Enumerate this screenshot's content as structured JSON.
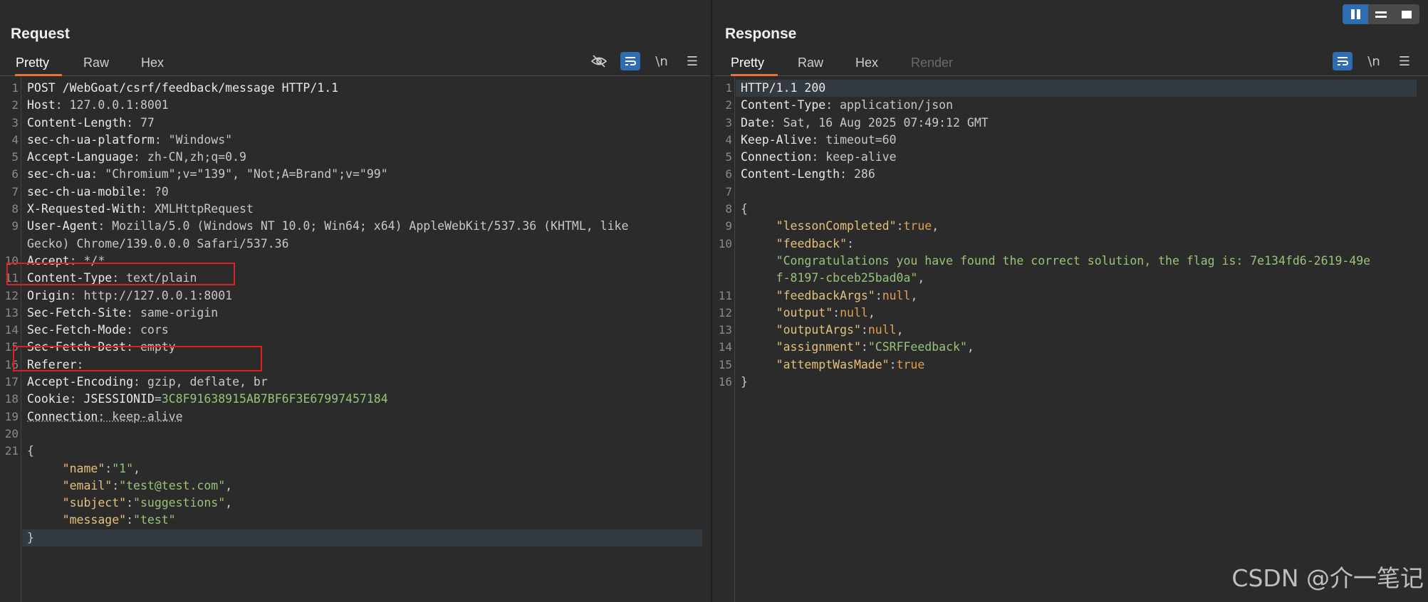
{
  "request": {
    "title": "Request",
    "tabs": [
      "Pretty",
      "Raw",
      "Hex"
    ],
    "active_tab": "Pretty",
    "lines": [
      {
        "n": "1",
        "segs": [
          [
            "k",
            "POST /WebGoat/csrf/feedback/message HTTP/1.1"
          ]
        ]
      },
      {
        "n": "2",
        "segs": [
          [
            "k",
            "Host"
          ],
          [
            "v",
            ": 127.0.0.1:8001"
          ]
        ]
      },
      {
        "n": "3",
        "segs": [
          [
            "k",
            "Content-Length"
          ],
          [
            "v",
            ": 77"
          ]
        ]
      },
      {
        "n": "4",
        "segs": [
          [
            "k",
            "sec-ch-ua-platform"
          ],
          [
            "v",
            ": \"Windows\""
          ]
        ]
      },
      {
        "n": "5",
        "segs": [
          [
            "k",
            "Accept-Language"
          ],
          [
            "v",
            ": zh-CN,zh;q=0.9"
          ]
        ]
      },
      {
        "n": "6",
        "segs": [
          [
            "k",
            "sec-ch-ua"
          ],
          [
            "v",
            ": \"Chromium\";v=\"139\", \"Not;A=Brand\";v=\"99\""
          ]
        ]
      },
      {
        "n": "7",
        "segs": [
          [
            "k",
            "sec-ch-ua-mobile"
          ],
          [
            "v",
            ": ?0"
          ]
        ]
      },
      {
        "n": "8",
        "segs": [
          [
            "k",
            "X-Requested-With"
          ],
          [
            "v",
            ": XMLHttpRequest"
          ]
        ]
      },
      {
        "n": "9",
        "segs": [
          [
            "k",
            "User-Agent"
          ],
          [
            "v",
            ": Mozilla/5.0 (Windows NT 10.0; Win64; x64) AppleWebKit/537.36 (KHTML, like"
          ]
        ]
      },
      {
        "n": "",
        "segs": [
          [
            "v",
            "Gecko) Chrome/139.0.0.0 Safari/537.36"
          ]
        ]
      },
      {
        "n": "10",
        "segs": [
          [
            "k",
            "Accept"
          ],
          [
            "v",
            ": */*"
          ]
        ]
      },
      {
        "n": "11",
        "segs": [
          [
            "k",
            "Content-Type"
          ],
          [
            "v",
            ": text/plain"
          ]
        ]
      },
      {
        "n": "12",
        "segs": [
          [
            "k",
            "Origin"
          ],
          [
            "v",
            ": http://127.0.0.1:8001"
          ]
        ]
      },
      {
        "n": "13",
        "segs": [
          [
            "k",
            "Sec-Fetch-Site"
          ],
          [
            "v",
            ": same-origin"
          ]
        ]
      },
      {
        "n": "14",
        "segs": [
          [
            "k",
            "Sec-Fetch-Mode"
          ],
          [
            "v",
            ": cors"
          ]
        ]
      },
      {
        "n": "15",
        "segs": [
          [
            "k",
            "Sec-Fetch-Dest"
          ],
          [
            "v",
            ": empty"
          ]
        ]
      },
      {
        "n": "16",
        "segs": [
          [
            "k",
            "Referer"
          ],
          [
            "v",
            ":"
          ]
        ]
      },
      {
        "n": "17",
        "segs": [
          [
            "k",
            "Accept-Encoding"
          ],
          [
            "v",
            ": gzip, deflate, br"
          ]
        ]
      },
      {
        "n": "18",
        "segs": [
          [
            "k",
            "Cookie"
          ],
          [
            "v",
            ": "
          ],
          [
            "k",
            "JSESSIONID"
          ],
          [
            "v",
            "="
          ],
          [
            "sid",
            "3C8F91638915AB7BF6F3E67997457184"
          ]
        ]
      },
      {
        "n": "19",
        "segs": [
          [
            "k uline",
            "Connection"
          ],
          [
            "v uline",
            ": keep-alive"
          ]
        ]
      },
      {
        "n": "20",
        "segs": []
      },
      {
        "n": "21",
        "segs": [
          [
            "v",
            "{"
          ]
        ]
      },
      {
        "n": "",
        "segs": [
          [
            "v",
            "     "
          ],
          [
            "jk",
            "\"name\""
          ],
          [
            "v",
            ":"
          ],
          [
            "js",
            "\"1\""
          ],
          [
            "v",
            ","
          ]
        ]
      },
      {
        "n": "",
        "segs": [
          [
            "v",
            "     "
          ],
          [
            "jk",
            "\"email\""
          ],
          [
            "v",
            ":"
          ],
          [
            "js",
            "\"test@test.com\""
          ],
          [
            "v",
            ","
          ]
        ]
      },
      {
        "n": "",
        "segs": [
          [
            "v",
            "     "
          ],
          [
            "jk",
            "\"subject\""
          ],
          [
            "v",
            ":"
          ],
          [
            "js",
            "\"suggestions\""
          ],
          [
            "v",
            ","
          ]
        ]
      },
      {
        "n": "",
        "segs": [
          [
            "v",
            "     "
          ],
          [
            "jk",
            "\"message\""
          ],
          [
            "v",
            ":"
          ],
          [
            "js",
            "\"test\""
          ]
        ]
      },
      {
        "n": "",
        "segs": [
          [
            "v",
            "}"
          ]
        ],
        "highlight": true
      }
    ]
  },
  "response": {
    "title": "Response",
    "tabs": [
      "Pretty",
      "Raw",
      "Hex",
      "Render"
    ],
    "active_tab": "Pretty",
    "lines": [
      {
        "n": "1",
        "segs": [
          [
            "k",
            "HTTP/1.1 200"
          ]
        ],
        "highlight": true
      },
      {
        "n": "2",
        "segs": [
          [
            "k",
            "Content-Type"
          ],
          [
            "v",
            ": application/json"
          ]
        ]
      },
      {
        "n": "3",
        "segs": [
          [
            "k",
            "Date"
          ],
          [
            "v",
            ": Sat, 16 Aug 2025 07:49:12 GMT"
          ]
        ]
      },
      {
        "n": "4",
        "segs": [
          [
            "k",
            "Keep-Alive"
          ],
          [
            "v",
            ": timeout=60"
          ]
        ]
      },
      {
        "n": "5",
        "segs": [
          [
            "k",
            "Connection"
          ],
          [
            "v",
            ": keep-alive"
          ]
        ]
      },
      {
        "n": "6",
        "segs": [
          [
            "k",
            "Content-Length"
          ],
          [
            "v",
            ": 286"
          ]
        ]
      },
      {
        "n": "7",
        "segs": []
      },
      {
        "n": "8",
        "segs": [
          [
            "v",
            "{"
          ]
        ]
      },
      {
        "n": "9",
        "segs": [
          [
            "v",
            "     "
          ],
          [
            "jk",
            "\"lessonCompleted\""
          ],
          [
            "v",
            ":"
          ],
          [
            "jl",
            "true"
          ],
          [
            "v",
            ","
          ]
        ]
      },
      {
        "n": "10",
        "segs": [
          [
            "v",
            "     "
          ],
          [
            "jk",
            "\"feedback\""
          ],
          [
            "v",
            ":"
          ]
        ]
      },
      {
        "n": "",
        "segs": [
          [
            "v",
            "     "
          ],
          [
            "js",
            "\"Congratulations you have found the correct solution, the flag is: 7e134fd6-2619-49e"
          ]
        ]
      },
      {
        "n": "",
        "segs": [
          [
            "v",
            "     "
          ],
          [
            "js",
            "f-8197-cbceb25bad0a\""
          ],
          [
            "v",
            ","
          ]
        ]
      },
      {
        "n": "11",
        "segs": [
          [
            "v",
            "     "
          ],
          [
            "jk",
            "\"feedbackArgs\""
          ],
          [
            "v",
            ":"
          ],
          [
            "jl",
            "null"
          ],
          [
            "v",
            ","
          ]
        ]
      },
      {
        "n": "12",
        "segs": [
          [
            "v",
            "     "
          ],
          [
            "jk",
            "\"output\""
          ],
          [
            "v",
            ":"
          ],
          [
            "jl",
            "null"
          ],
          [
            "v",
            ","
          ]
        ]
      },
      {
        "n": "13",
        "segs": [
          [
            "v",
            "     "
          ],
          [
            "jk",
            "\"outputArgs\""
          ],
          [
            "v",
            ":"
          ],
          [
            "jl",
            "null"
          ],
          [
            "v",
            ","
          ]
        ]
      },
      {
        "n": "14",
        "segs": [
          [
            "v",
            "     "
          ],
          [
            "jk",
            "\"assignment\""
          ],
          [
            "v",
            ":"
          ],
          [
            "js",
            "\"CSRFFeedback\""
          ],
          [
            "v",
            ","
          ]
        ]
      },
      {
        "n": "15",
        "segs": [
          [
            "v",
            "     "
          ],
          [
            "jk",
            "\"attemptWasMade\""
          ],
          [
            "v",
            ":"
          ],
          [
            "jl",
            "true"
          ]
        ]
      },
      {
        "n": "16",
        "segs": [
          [
            "v",
            "}"
          ]
        ]
      }
    ]
  },
  "toolbar_icons": {
    "request": [
      "hide-icon",
      "wrap-icon",
      "newline-icon",
      "menu-icon"
    ],
    "response": [
      "wrap-icon",
      "newline-icon",
      "menu-icon"
    ],
    "newline_label": "\\n"
  },
  "colors": {
    "accent": "#e8743b",
    "highlight_box": "#e02020",
    "toggle_blue": "#2f6db3"
  },
  "watermark": "CSDN @介一笔记"
}
